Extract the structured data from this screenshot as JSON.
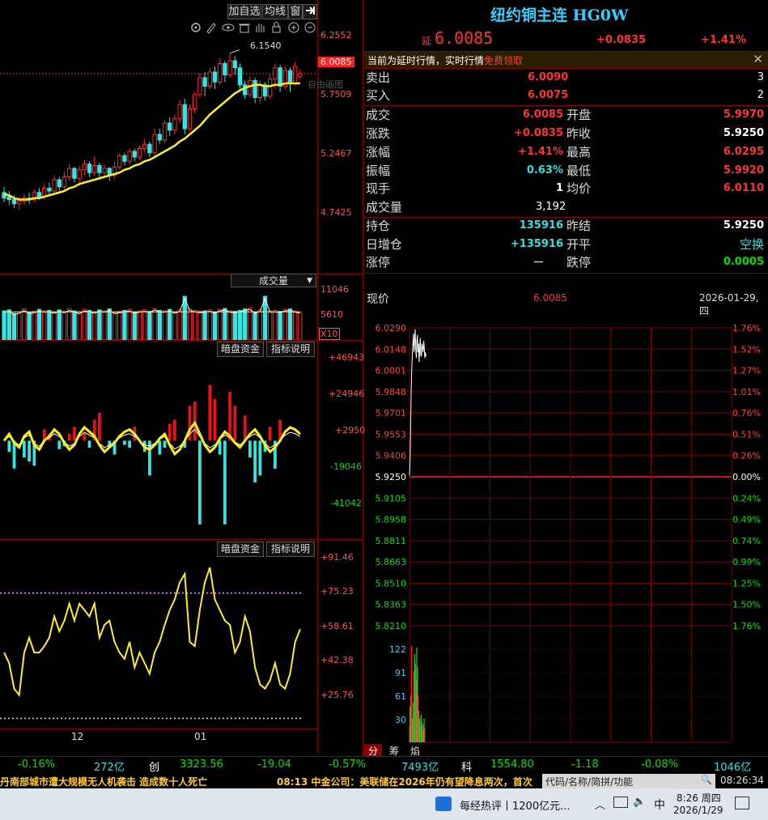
{
  "toolbar": {
    "add_watch": "加自选",
    "avg_line": "均线",
    "window_icon": "窗",
    "pin_icon": "pin-icon"
  },
  "kline": {
    "price_labels": [
      "6.2552",
      "5.7509",
      "5.2467",
      "4.7425"
    ],
    "current_price_tag": "6.0085",
    "high_annotation": "6.1540",
    "ghost_label": "自由画图",
    "candles": [
      {
        "o": 5.17,
        "c": 5.13,
        "h": 5.21,
        "l": 5.1
      },
      {
        "o": 5.14,
        "c": 5.12,
        "h": 5.18,
        "l": 5.08
      },
      {
        "o": 5.12,
        "c": 5.09,
        "h": 5.15,
        "l": 5.06
      },
      {
        "o": 5.09,
        "c": 5.11,
        "h": 5.14,
        "l": 5.05
      },
      {
        "o": 5.11,
        "c": 5.13,
        "h": 5.16,
        "l": 5.08
      },
      {
        "o": 5.13,
        "c": 5.12,
        "h": 5.17,
        "l": 5.09
      },
      {
        "o": 5.12,
        "c": 5.17,
        "h": 5.19,
        "l": 5.1
      },
      {
        "o": 5.17,
        "c": 5.14,
        "h": 5.2,
        "l": 5.12
      },
      {
        "o": 5.14,
        "c": 5.2,
        "h": 5.23,
        "l": 5.12
      },
      {
        "o": 5.2,
        "c": 5.18,
        "h": 5.24,
        "l": 5.15
      },
      {
        "o": 5.18,
        "c": 5.26,
        "h": 5.29,
        "l": 5.16
      },
      {
        "o": 5.26,
        "c": 5.21,
        "h": 5.28,
        "l": 5.18
      },
      {
        "o": 5.21,
        "c": 5.28,
        "h": 5.32,
        "l": 5.19
      },
      {
        "o": 5.28,
        "c": 5.34,
        "h": 5.37,
        "l": 5.25
      },
      {
        "o": 5.34,
        "c": 5.27,
        "h": 5.35,
        "l": 5.24
      },
      {
        "o": 5.27,
        "c": 5.33,
        "h": 5.36,
        "l": 5.24
      },
      {
        "o": 5.33,
        "c": 5.37,
        "h": 5.4,
        "l": 5.29
      },
      {
        "o": 5.37,
        "c": 5.31,
        "h": 5.39,
        "l": 5.28
      },
      {
        "o": 5.31,
        "c": 5.36,
        "h": 5.42,
        "l": 5.29
      },
      {
        "o": 5.36,
        "c": 5.31,
        "h": 5.38,
        "l": 5.26
      },
      {
        "o": 5.31,
        "c": 5.34,
        "h": 5.37,
        "l": 5.28
      },
      {
        "o": 5.34,
        "c": 5.29,
        "h": 5.35,
        "l": 5.25
      },
      {
        "o": 5.29,
        "c": 5.35,
        "h": 5.39,
        "l": 5.27
      },
      {
        "o": 5.35,
        "c": 5.43,
        "h": 5.45,
        "l": 5.33
      },
      {
        "o": 5.43,
        "c": 5.39,
        "h": 5.45,
        "l": 5.36
      },
      {
        "o": 5.39,
        "c": 5.46,
        "h": 5.48,
        "l": 5.37
      },
      {
        "o": 5.46,
        "c": 5.42,
        "h": 5.48,
        "l": 5.39
      },
      {
        "o": 5.42,
        "c": 5.48,
        "h": 5.5,
        "l": 5.4
      },
      {
        "o": 5.48,
        "c": 5.51,
        "h": 5.55,
        "l": 5.45
      },
      {
        "o": 5.51,
        "c": 5.45,
        "h": 5.53,
        "l": 5.42
      },
      {
        "o": 5.45,
        "c": 5.58,
        "h": 5.62,
        "l": 5.43
      },
      {
        "o": 5.58,
        "c": 5.54,
        "h": 5.62,
        "l": 5.51
      },
      {
        "o": 5.54,
        "c": 5.66,
        "h": 5.68,
        "l": 5.52
      },
      {
        "o": 5.66,
        "c": 5.61,
        "h": 5.7,
        "l": 5.57
      },
      {
        "o": 5.61,
        "c": 5.69,
        "h": 5.72,
        "l": 5.58
      },
      {
        "o": 5.69,
        "c": 5.79,
        "h": 5.82,
        "l": 5.66
      },
      {
        "o": 5.79,
        "c": 5.62,
        "h": 5.83,
        "l": 5.58
      },
      {
        "o": 5.62,
        "c": 5.76,
        "h": 5.79,
        "l": 5.6
      },
      {
        "o": 5.76,
        "c": 5.86,
        "h": 5.88,
        "l": 5.73
      },
      {
        "o": 5.86,
        "c": 5.98,
        "h": 6.01,
        "l": 5.84
      },
      {
        "o": 5.98,
        "c": 5.92,
        "h": 6.02,
        "l": 5.85
      },
      {
        "o": 5.92,
        "c": 6.02,
        "h": 6.05,
        "l": 5.9
      },
      {
        "o": 6.02,
        "c": 5.95,
        "h": 6.06,
        "l": 5.9
      },
      {
        "o": 5.95,
        "c": 6.08,
        "h": 6.12,
        "l": 5.93
      },
      {
        "o": 6.08,
        "c": 6.0,
        "h": 6.1,
        "l": 5.95
      },
      {
        "o": 6.0,
        "c": 6.1,
        "h": 6.154,
        "l": 5.98
      },
      {
        "o": 6.1,
        "c": 6.05,
        "h": 6.13,
        "l": 6.0
      },
      {
        "o": 6.05,
        "c": 5.93,
        "h": 6.08,
        "l": 5.9
      },
      {
        "o": 5.93,
        "c": 5.86,
        "h": 5.96,
        "l": 5.83
      },
      {
        "o": 5.86,
        "c": 5.96,
        "h": 5.99,
        "l": 5.84
      },
      {
        "o": 5.96,
        "c": 5.84,
        "h": 5.98,
        "l": 5.8
      },
      {
        "o": 5.84,
        "c": 5.93,
        "h": 5.96,
        "l": 5.8
      },
      {
        "o": 5.93,
        "c": 5.85,
        "h": 5.95,
        "l": 5.82
      },
      {
        "o": 5.85,
        "c": 5.97,
        "h": 6.0,
        "l": 5.83
      },
      {
        "o": 5.97,
        "c": 6.05,
        "h": 6.08,
        "l": 5.9
      },
      {
        "o": 6.05,
        "c": 5.92,
        "h": 6.07,
        "l": 5.88
      },
      {
        "o": 5.92,
        "c": 6.03,
        "h": 6.06,
        "l": 5.9
      },
      {
        "o": 6.03,
        "c": 5.94,
        "h": 6.05,
        "l": 5.88
      },
      {
        "o": 5.94,
        "c": 6.06,
        "h": 6.09,
        "l": 5.92
      },
      {
        "o": 5.99,
        "c": 6.01,
        "h": 6.04,
        "l": 5.97
      }
    ],
    "ma": [
      5.16,
      5.15,
      5.13,
      5.12,
      5.12,
      5.12,
      5.13,
      5.13,
      5.14,
      5.15,
      5.16,
      5.17,
      5.18,
      5.2,
      5.21,
      5.23,
      5.24,
      5.25,
      5.26,
      5.27,
      5.28,
      5.29,
      5.3,
      5.31,
      5.33,
      5.34,
      5.36,
      5.37,
      5.39,
      5.4,
      5.42,
      5.44,
      5.46,
      5.48,
      5.5,
      5.53,
      5.55,
      5.58,
      5.61,
      5.64,
      5.68,
      5.72,
      5.75,
      5.78,
      5.81,
      5.84,
      5.87,
      5.89,
      5.91,
      5.92,
      5.93,
      5.93,
      5.92,
      5.92,
      5.93,
      5.93,
      5.94,
      5.94,
      5.94,
      5.94
    ],
    "ylim": [
      4.7,
      6.3
    ]
  },
  "volume": {
    "selector_label": "成交量",
    "labels": [
      "11046",
      "5610"
    ],
    "x10": "X10",
    "values": [
      60,
      62,
      55,
      58,
      64,
      57,
      59,
      63,
      60,
      61,
      58,
      62,
      59,
      64,
      60,
      57,
      63,
      61,
      58,
      62,
      60,
      64,
      57,
      59,
      61,
      63,
      58,
      60,
      62,
      59,
      65,
      61,
      60,
      63,
      58,
      62,
      90,
      64,
      61,
      59,
      60,
      62,
      58,
      63,
      65,
      60,
      59,
      61,
      64,
      66,
      58,
      62,
      90,
      60,
      61,
      59,
      63,
      64,
      60,
      58
    ],
    "ymax": 100
  },
  "money_flow": {
    "btn_dark": "暗盘资金",
    "btn_desc": "指标说明",
    "labels": [
      "+46943",
      "+24946",
      "+2950",
      "-19046",
      "-41042"
    ],
    "bars": [
      0,
      -8,
      -20,
      0,
      -12,
      -15,
      -18,
      0,
      8,
      5,
      0,
      -6,
      -4,
      5,
      10,
      0,
      6,
      -5,
      15,
      20,
      0,
      -5,
      -10,
      0,
      -3,
      -5,
      10,
      0,
      -8,
      -25,
      0,
      -10,
      -5,
      12,
      15,
      0,
      -5,
      25,
      28,
      -60,
      0,
      40,
      30,
      -10,
      -60,
      35,
      25,
      0,
      18,
      -12,
      -30,
      -25,
      -8,
      10,
      -20,
      15,
      0,
      0,
      0,
      0
    ],
    "line": [
      0,
      3,
      -1,
      -3,
      2,
      4,
      -2,
      -4,
      0,
      2,
      5,
      3,
      -1,
      -4,
      -2,
      3,
      6,
      4,
      2,
      -2,
      -5,
      -3,
      -1,
      2,
      4,
      5,
      3,
      0,
      -3,
      -4,
      -2,
      1,
      3,
      -2,
      -6,
      -4,
      0,
      5,
      8,
      3,
      -2,
      -5,
      -3,
      1,
      4,
      2,
      -1,
      -3,
      0,
      3,
      5,
      2,
      -2,
      -5,
      -3,
      0,
      4,
      6,
      5,
      3
    ],
    "ymin": -70,
    "ymax": 60
  },
  "oscillator": {
    "btn_dark": "暗盘资金",
    "btn_desc": "指标说明",
    "labels": [
      "+91.46",
      "+75.23",
      "+58.61",
      "+42.38",
      "+25.76"
    ],
    "values": [
      55,
      50,
      38,
      35,
      55,
      62,
      55,
      55,
      58,
      62,
      72,
      65,
      70,
      78,
      70,
      78,
      75,
      72,
      78,
      62,
      68,
      70,
      60,
      55,
      52,
      60,
      48,
      55,
      50,
      45,
      55,
      60,
      68,
      75,
      80,
      88,
      92,
      60,
      58,
      75,
      88,
      95,
      80,
      75,
      70,
      68,
      55,
      60,
      72,
      65,
      48,
      40,
      38,
      42,
      50,
      40,
      38,
      45,
      60,
      66
    ],
    "ylim": [
      20,
      100
    ],
    "upper": 83,
    "lower": 24
  },
  "date_axis": {
    "dec": "12",
    "jan": "01"
  },
  "quote": {
    "title": "纽约铜主连 HG0W",
    "delay_tag": "延",
    "price": "6.0085",
    "change": "+0.0835",
    "change_pct": "+1.41%",
    "notice": "当前为延时行情，实时行情",
    "notice_link": "免费领取",
    "ask_label": "卖出",
    "ask_price": "6.0090",
    "ask_size": "3",
    "bid_label": "买入",
    "bid_price": "6.0075",
    "bid_size": "2",
    "rows": [
      {
        "l1": "成交",
        "v1": "6.0085",
        "l2": "开盘",
        "v2": "5.9970"
      },
      {
        "l1": "涨跌",
        "v1": "+0.0835",
        "l2": "昨收",
        "v2": "5.9250"
      },
      {
        "l1": "涨幅",
        "v1": "+1.41%",
        "l2": "最高",
        "v2": "6.0295"
      },
      {
        "l1": "振幅",
        "v1": "0.63%",
        "l2": "最低",
        "v2": "5.9920"
      },
      {
        "l1": "现手",
        "v1": "1",
        "l2": "均价",
        "v2": "6.0110"
      }
    ],
    "volume_label": "成交量",
    "volume_value": "3,192",
    "oi_label": "持仓",
    "oi_value": "135916",
    "prev_settle_label": "昨结",
    "prev_settle_value": "5.9250",
    "daily_oi_label": "日增仓",
    "daily_oi_value": "+135916",
    "open_flat_label": "开平",
    "open_flat_value": "空换",
    "limit_up_label": "涨停",
    "limit_up_value": "－",
    "limit_down_label": "跌停",
    "limit_down_value": "0.0005"
  },
  "intraday": {
    "label": "现价",
    "price": "6.0085",
    "date": "2026-01-29,四",
    "left_labels": [
      "6.0290",
      "6.0148",
      "6.0001",
      "5.9848",
      "5.9701",
      "5.9553",
      "5.9406",
      "5.9250",
      "5.9105",
      "5.8958",
      "5.8811",
      "5.8663",
      "5.8510",
      "5.8363",
      "5.8210"
    ],
    "right_labels": [
      "1.76%",
      "1.52%",
      "1.27%",
      "1.01%",
      "0.76%",
      "0.51%",
      "0.26%",
      "0.00%",
      "0.24%",
      "0.49%",
      "0.74%",
      "0.99%",
      "1.25%",
      "1.50%",
      "1.76%"
    ],
    "vol_labels": [
      "122",
      "91",
      "61",
      "30"
    ],
    "prices": [
      5.926,
      5.936,
      5.96,
      5.985,
      6.0,
      6.01,
      6.018,
      6.025,
      6.012,
      6.02,
      6.028,
      6.015,
      6.008,
      6.02,
      6.024,
      6.012,
      6.018,
      6.005,
      6.014,
      6.022,
      6.01,
      6.009,
      6.018,
      6.015,
      6.012,
      6.02,
      6.016,
      6.008,
      6.012,
      6.009
    ],
    "vols": [
      20,
      45,
      60,
      122,
      30,
      50,
      90,
      112,
      100,
      80,
      120,
      95,
      60,
      40,
      30,
      20,
      35,
      25,
      15,
      22,
      30,
      18
    ],
    "ylim": [
      5.821,
      6.029
    ],
    "tabs": [
      "分",
      "筹",
      "焰"
    ]
  },
  "ticker": {
    "a": "-0.16%",
    "b": "272亿",
    "c": "创",
    "d": "3323.56",
    "e": "-19.04",
    "f": "-0.57%",
    "g": "7493亿",
    "h": "科",
    "i": "1554.80",
    "j": "-1.18",
    "k": "-0.08%",
    "l": "1046亿"
  },
  "news": {
    "left": "丹南部城市遭大规模无人机袭击 造成数十人死亡",
    "right": "08:13 中金公司：美联储在2026年仍有望降息两次，首次",
    "search_placeholder": "代码/名称/简拼/功能",
    "clock": "08:26:34"
  },
  "taskbar": {
    "news_label": "每经热评丨1200亿元...",
    "lang": "中",
    "time": "8:26 周四",
    "date": "2026/1/29"
  }
}
